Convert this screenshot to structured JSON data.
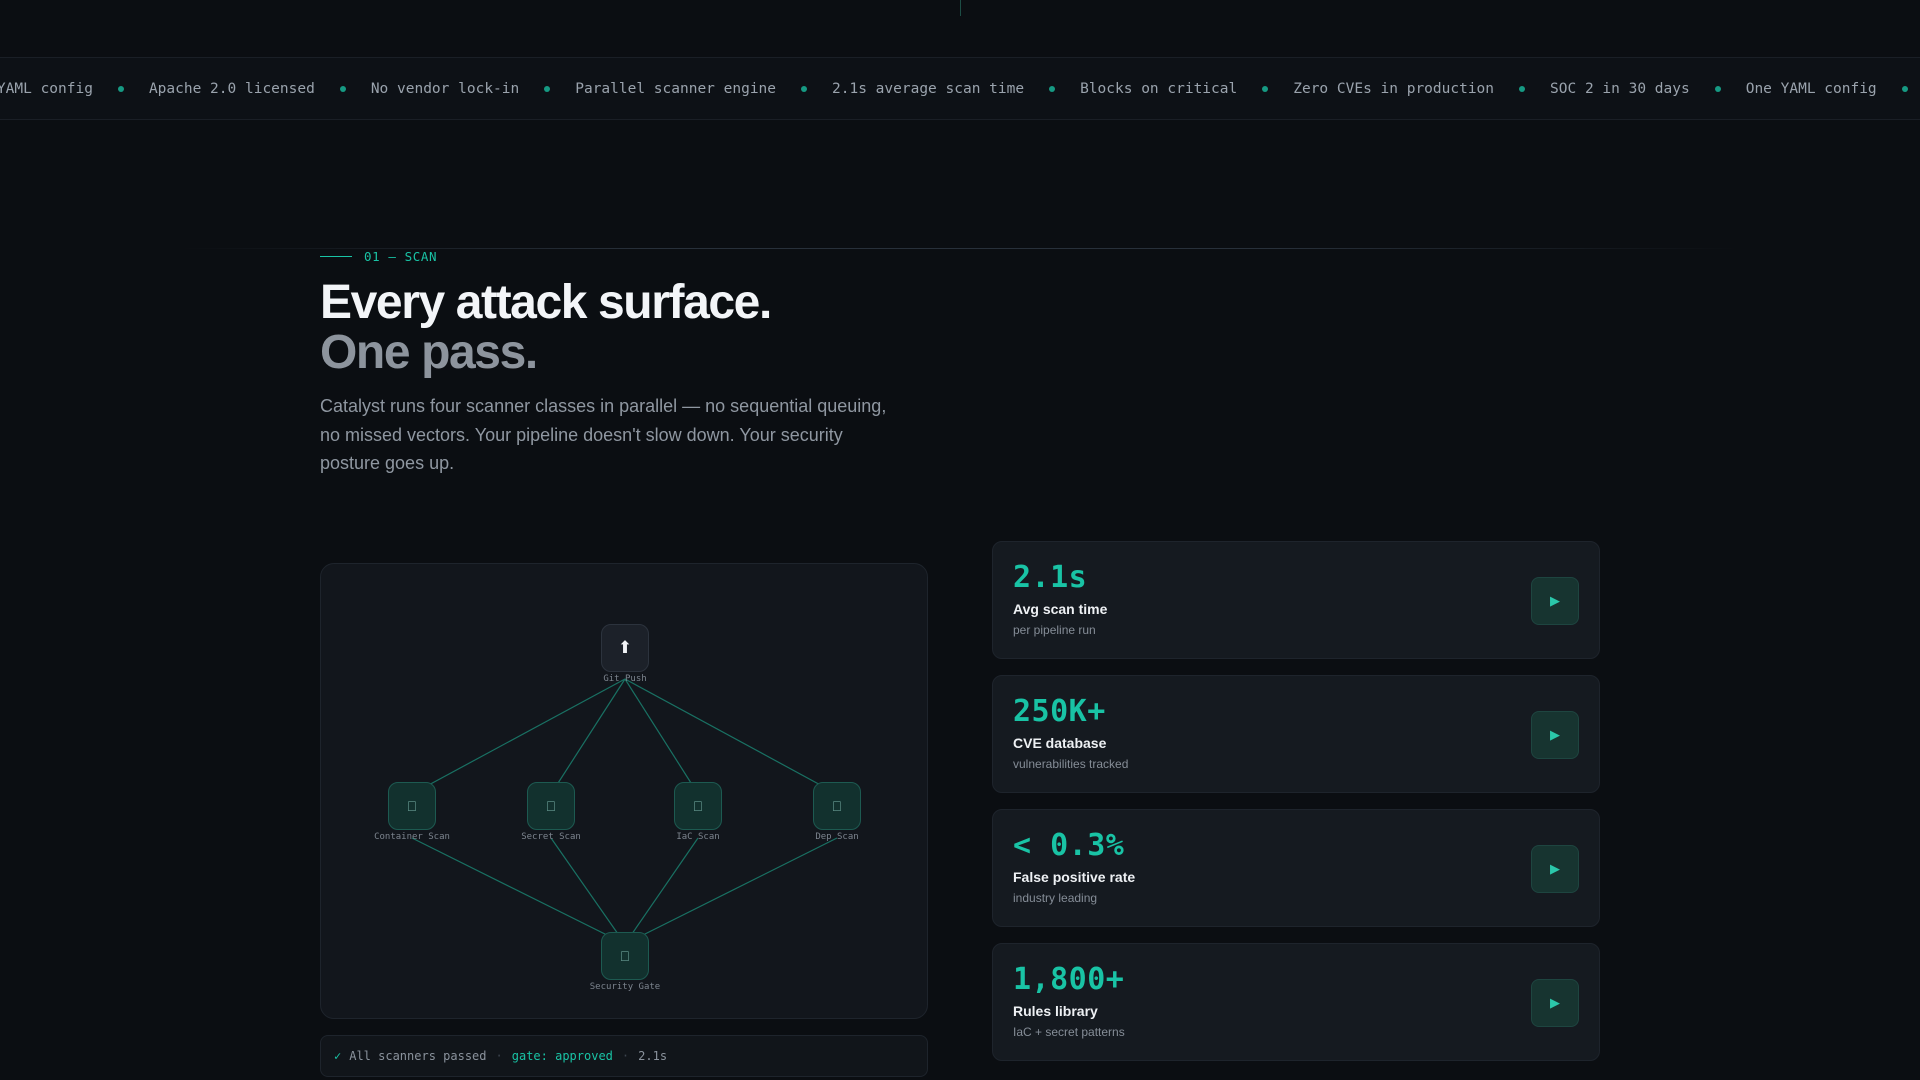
{
  "ticker": {
    "items": [
      "One YAML config",
      "Apache 2.0 licensed",
      "No vendor lock-in",
      "Parallel scanner engine",
      "2.1s average scan time",
      "Blocks on critical",
      "Zero CVEs in production",
      "SOC 2 in 30 days",
      "One YAML config"
    ]
  },
  "section": {
    "eyebrow": "01 — SCAN",
    "headline_line1": "Every attack surface.",
    "headline_line2": "One pass.",
    "lead": "Catalyst runs four scanner classes in parallel — no sequential queuing, no missed vectors. Your pipeline doesn't slow down. Your security posture goes up."
  },
  "diagram": {
    "source": {
      "label": "Git Push",
      "icon": "upload-arrow-icon",
      "glyph": "⬆"
    },
    "scanners": [
      {
        "label": "Container Scan",
        "icon": "container-icon",
        "glyph": "⎕"
      },
      {
        "label": "Secret Scan",
        "icon": "secret-icon",
        "glyph": "⎕"
      },
      {
        "label": "IaC Scan",
        "icon": "iac-icon",
        "glyph": "⎕"
      },
      {
        "label": "Dep Scan",
        "icon": "dependency-icon",
        "glyph": "⎕"
      }
    ],
    "gate": {
      "label": "Security Gate",
      "icon": "gate-icon",
      "glyph": "⎕"
    }
  },
  "status": {
    "check": "✓",
    "text": "All scanners passed",
    "sep": "·",
    "gate": "gate: approved",
    "time": "2.1s"
  },
  "stats": [
    {
      "value": "2.1s",
      "label": "Avg scan time",
      "sub": "per pipeline run",
      "button": "▶"
    },
    {
      "value": "250K+",
      "label": "CVE database",
      "sub": "vulnerabilities tracked",
      "button": "▶"
    },
    {
      "value": "< 0.3%",
      "label": "False positive rate",
      "sub": "industry leading",
      "button": "▶"
    },
    {
      "value": "1,800+",
      "label": "Rules library",
      "sub": "IaC + secret patterns",
      "button": "▶"
    }
  ],
  "colors": {
    "accent": "#19c3a5",
    "background": "#0b0e12",
    "card": "#151a20"
  }
}
